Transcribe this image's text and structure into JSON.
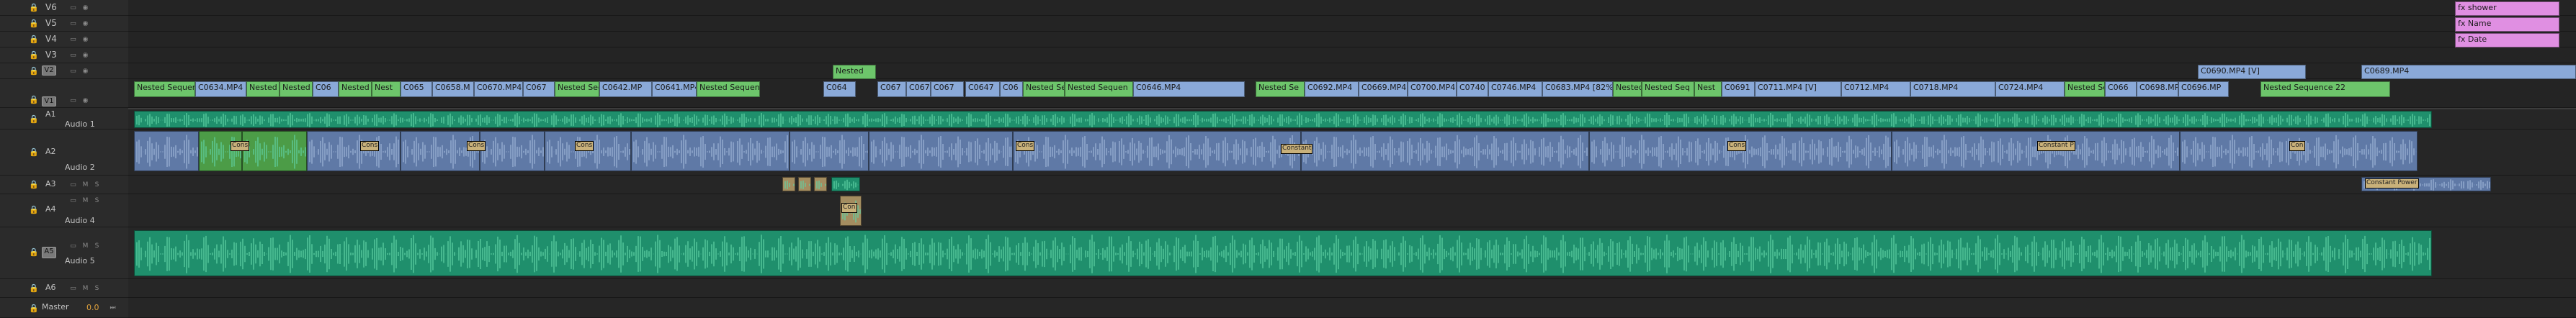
{
  "video_tracks": [
    {
      "name": "V6"
    },
    {
      "name": "V5"
    },
    {
      "name": "V4"
    },
    {
      "name": "V3"
    },
    {
      "name": "V2"
    },
    {
      "name": "V1"
    }
  ],
  "audio_tracks": [
    {
      "name": "A1",
      "label": "Audio 1"
    },
    {
      "name": "A2",
      "label": "Audio 2"
    },
    {
      "name": "A3",
      "label": ""
    },
    {
      "name": "A4",
      "label": "Audio 4"
    },
    {
      "name": "A5",
      "label": "Audio 5"
    },
    {
      "name": "A6",
      "label": ""
    }
  ],
  "master": {
    "label": "Master",
    "volume": "0.0"
  },
  "buttons": {
    "mute": "M",
    "solo": "S"
  },
  "v_clips": [
    {
      "label": "fx shower"
    },
    {
      "label": "fx Name"
    },
    {
      "label": "fx Date"
    },
    {
      "label": "Nested"
    },
    {
      "label": "C0690.MP4 [V]"
    },
    {
      "label": "C0689.MP4"
    },
    {
      "label": "Nested Sequence"
    },
    {
      "label": "C0634.MP4"
    },
    {
      "label": "Nested"
    },
    {
      "label": "Nested"
    },
    {
      "label": "C06"
    },
    {
      "label": "Nested"
    },
    {
      "label": "Nest"
    },
    {
      "label": "C065"
    },
    {
      "label": "C0658.M"
    },
    {
      "label": "C0670.MP4"
    },
    {
      "label": "C067"
    },
    {
      "label": "Nested Seq"
    },
    {
      "label": "C0642.MP"
    },
    {
      "label": "C0641.MP4"
    },
    {
      "label": "Nested Sequen"
    },
    {
      "label": "C064"
    },
    {
      "label": "C067"
    },
    {
      "label": "C067"
    },
    {
      "label": "C067"
    },
    {
      "label": "C0647"
    },
    {
      "label": "C06"
    },
    {
      "label": "Nested Se"
    },
    {
      "label": "Nested Sequen"
    },
    {
      "label": "C0646.MP4"
    },
    {
      "label": "Nested Se"
    },
    {
      "label": "C0692.MP4"
    },
    {
      "label": "C0669.MP4"
    },
    {
      "label": "C0700.MP4"
    },
    {
      "label": "C0740"
    },
    {
      "label": "C0746.MP4"
    },
    {
      "label": "C0683.MP4 [82%]"
    },
    {
      "label": "Nested"
    },
    {
      "label": "Nested Seq"
    },
    {
      "label": "Nest"
    },
    {
      "label": "C0691"
    },
    {
      "label": "C0711.MP4 [V]"
    },
    {
      "label": "C0712.MP4"
    },
    {
      "label": "C0718.MP4"
    },
    {
      "label": "C0724.MP4"
    },
    {
      "label": "Nested Se"
    },
    {
      "label": "C066"
    },
    {
      "label": "C0698.MP4"
    },
    {
      "label": "C0696.MP"
    },
    {
      "label": "Nested Sequence 22"
    }
  ],
  "transitions": [
    {
      "label": "Cons"
    },
    {
      "label": "Cons"
    },
    {
      "label": "Cons"
    },
    {
      "label": "Cons"
    },
    {
      "label": "Cons"
    },
    {
      "label": "Constant"
    },
    {
      "label": "Constant P"
    },
    {
      "label": "Constant Power"
    },
    {
      "label": "Con"
    },
    {
      "label": "Con"
    },
    {
      "label": "Cons"
    }
  ],
  "colors": {
    "accent_green": "#6dc56b",
    "accent_blue": "#8aa9d8",
    "accent_pink": "#e08fe2",
    "audio_teal": "#1f8f6c",
    "audio_blue": "#5f79a6",
    "volume": "#e0a13c"
  }
}
